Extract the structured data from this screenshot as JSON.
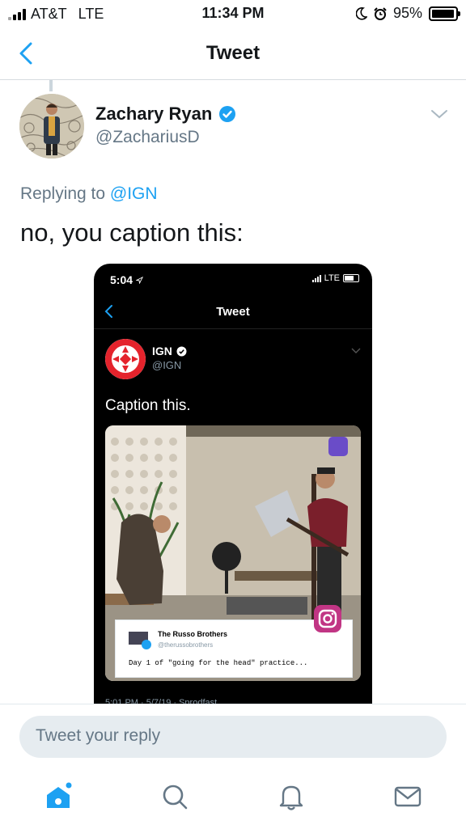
{
  "status_bar": {
    "carrier": "AT&T",
    "network": "LTE",
    "time": "11:34 PM",
    "battery": "95%"
  },
  "nav": {
    "title": "Tweet",
    "back_icon": "chevron-left-icon"
  },
  "tweet": {
    "author_name": "Zachary Ryan",
    "author_handle": "@ZachariusD",
    "verified": true,
    "replying_prefix": "Replying to",
    "replying_to": "@IGN",
    "text": "no, you caption this:"
  },
  "embedded_screenshot": {
    "status_time": "5:04",
    "status_network": "LTE",
    "nav_title": "Tweet",
    "author_name": "IGN",
    "author_handle": "@IGN",
    "text": "Caption this.",
    "card": {
      "name": "The Russo Brothers",
      "handle": "@therussobrothers",
      "text": "Day 1 of \"going for the head\" practice..."
    },
    "meta": "5:01 PM · 5/7/19 · Sprodfast"
  },
  "composer": {
    "placeholder": "Tweet your reply"
  },
  "tab_bar": {
    "items": [
      "home-icon",
      "search-icon",
      "notifications-icon",
      "messages-icon"
    ]
  },
  "colors": {
    "accent": "#1da1f2",
    "secondary_text": "#657786",
    "reply_box": "#e6ecf0",
    "ign_red": "#e4232c"
  }
}
